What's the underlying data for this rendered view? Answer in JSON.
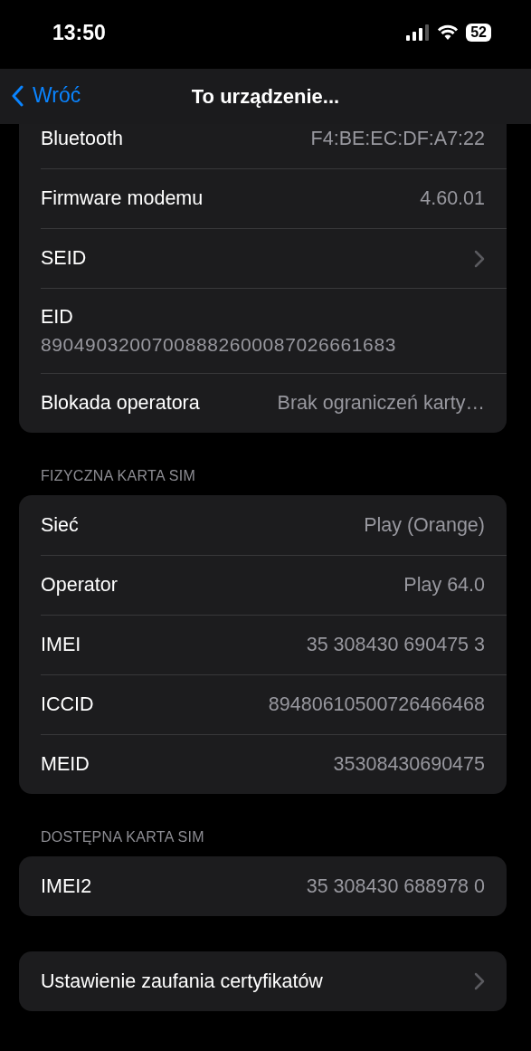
{
  "status_bar": {
    "time": "13:50",
    "battery": "52"
  },
  "nav": {
    "back": "Wróć",
    "title": "To urządzenie..."
  },
  "groups": [
    {
      "rows": [
        {
          "kind": "value",
          "label": "Bluetooth",
          "value": "F4:BE:EC:DF:A7:22"
        },
        {
          "kind": "value",
          "label": "Firmware modemu",
          "value": "4.60.01"
        },
        {
          "kind": "link",
          "label": "SEID"
        },
        {
          "kind": "stacked",
          "label": "EID",
          "value": "89049032007008882600087026661683"
        },
        {
          "kind": "value",
          "label": "Blokada operatora",
          "value": "Brak ograniczeń karty…"
        }
      ]
    },
    {
      "header": "FIZYCZNA KARTA SIM",
      "rows": [
        {
          "kind": "value",
          "label": "Sieć",
          "value": "Play (Orange)"
        },
        {
          "kind": "value",
          "label": "Operator",
          "value": "Play 64.0"
        },
        {
          "kind": "value",
          "label": "IMEI",
          "value": "35 308430 690475 3"
        },
        {
          "kind": "value",
          "label": "ICCID",
          "value": "89480610500726466468"
        },
        {
          "kind": "value",
          "label": "MEID",
          "value": "35308430690475"
        }
      ]
    },
    {
      "header": "DOSTĘPNA KARTA SIM",
      "rows": [
        {
          "kind": "value",
          "label": "IMEI2",
          "value": "35 308430 688978 0"
        }
      ]
    },
    {
      "rows": [
        {
          "kind": "link",
          "label": "Ustawienie zaufania certyfikatów"
        }
      ]
    }
  ]
}
